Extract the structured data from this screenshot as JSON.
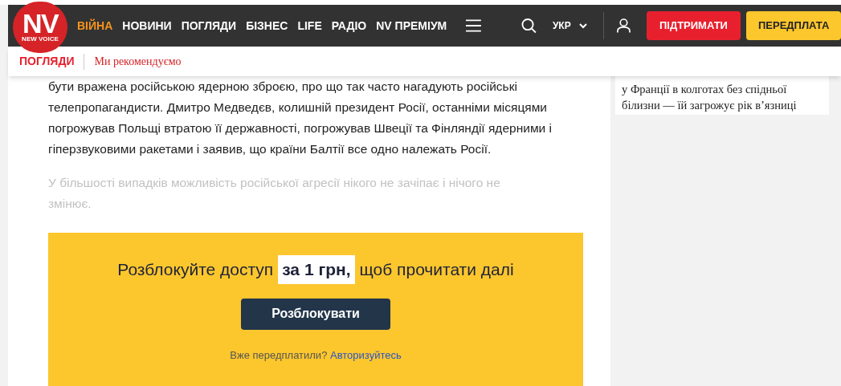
{
  "logo": {
    "mark": "NV",
    "tagline": "NEW VOICE"
  },
  "nav": [
    {
      "label": "ВІЙНА",
      "selected": true
    },
    {
      "label": "НОВИНИ",
      "selected": false
    },
    {
      "label": "ПОГЛЯДИ",
      "selected": false
    },
    {
      "label": "БІЗНЕС",
      "selected": false
    },
    {
      "label": "LIFE",
      "selected": false
    },
    {
      "label": "РАДІО",
      "selected": false
    },
    {
      "label": "NV ПРЕМІУМ",
      "selected": false
    }
  ],
  "language": "УКР",
  "support_button": "ПІДТРИМАТИ",
  "subscribe_button": "ПЕРЕДПЛАТА",
  "subnav": {
    "section": "ПОГЛЯДИ",
    "link": "Ми рекомендуємо"
  },
  "article": {
    "paragraphs": [
      "бути вражена російською ядерною зброєю, про що так часто нагадують російські телепропагандисти. Дмитро Медведєв, колишній президент Росії, останніми місяцями погрожував Польщі втратою її державності, погрожував Швеції та Фінляндії ядерними і гіперзвуковими ракетами і заявив, що країни Балтії все одно належать Росії."
    ],
    "faded_paragraph": "У більшості випадків можливість російської агресії нікого не зачіпає і нічого не змінює."
  },
  "paywall": {
    "before": "Розблокуйте доступ",
    "highlight": "за 1 грн,",
    "after": "щоб прочитати далі",
    "button": "Розблокувати",
    "note": "Вже передплатили?",
    "login_link": "Авторизуйтесь"
  },
  "sidebar": {
    "headline": "у Франції в колготах без спідньої білизни — їй загрожує рік в’язниці"
  }
}
